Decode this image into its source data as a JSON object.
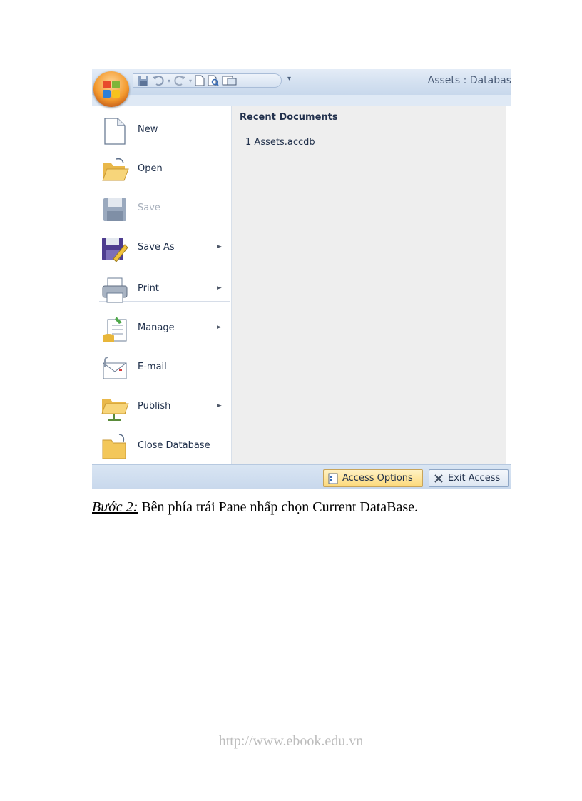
{
  "window": {
    "title": "Assets : Databas"
  },
  "quick_access_toolbar": {
    "icons": [
      "save-icon",
      "undo-icon",
      "redo-icon",
      "new-document-icon",
      "print-preview-icon",
      "spelling-icon"
    ],
    "customize_glyph": "▾"
  },
  "office_menu": {
    "items": [
      {
        "label": "New",
        "icon": "new-document-icon",
        "submenu": false,
        "enabled": true
      },
      {
        "label": "Open",
        "icon": "open-folder-icon",
        "submenu": false,
        "enabled": true
      },
      {
        "label": "Save",
        "icon": "save-icon",
        "submenu": false,
        "enabled": false
      },
      {
        "label": "Save As",
        "icon": "save-as-icon",
        "submenu": true,
        "enabled": true
      },
      {
        "label": "Print",
        "icon": "printer-icon",
        "submenu": true,
        "enabled": true
      },
      {
        "label": "Manage",
        "icon": "manage-icon",
        "submenu": true,
        "enabled": true
      },
      {
        "label": "E-mail",
        "icon": "email-icon",
        "submenu": false,
        "enabled": true
      },
      {
        "label": "Publish",
        "icon": "publish-icon",
        "submenu": true,
        "enabled": true
      },
      {
        "label": "Close Database",
        "icon": "close-database-icon",
        "submenu": false,
        "enabled": true
      }
    ],
    "submenu_arrow": "►"
  },
  "recent_documents": {
    "header": "Recent Documents",
    "items": [
      {
        "index": "1",
        "name": "Assets.accdb"
      }
    ]
  },
  "bottom_buttons": {
    "options_label": "Access Options",
    "exit_label": "Exit Access"
  },
  "caption": {
    "step": "Bước 2:",
    "text": " Bên phía trái Pane nhấp chọn Current DataBase."
  },
  "footer": {
    "url": "http://www.ebook.edu.vn"
  },
  "colors": {
    "office_button": "#f39a2e",
    "recent_header": "#22314d",
    "options_button": "#fcd97b"
  }
}
